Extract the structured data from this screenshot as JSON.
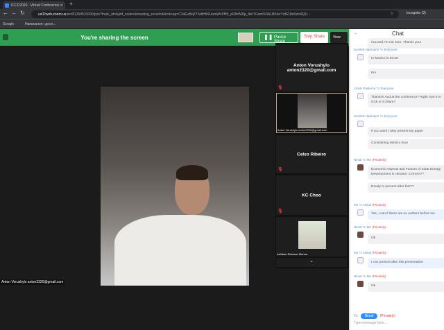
{
  "browser": {
    "tab_title": "ICCD2020 - Virtual Conference",
    "url_host": "us02web.zoom.us",
    "url_rest": "/wc/81269523090/join?track_id=&jmf_code=&meeting_result=&tk=&cap=C34GzBq272oBHiRUamWcPHft_sF8hW3lp_AtnTGam%3A1BKAcYzBZJbr0zio9QU...",
    "profile": "Incognito (3)",
    "bookmarks": [
      "Google",
      "Написання і досл..."
    ]
  },
  "share_bar": {
    "text": "You're sharing the screen",
    "pause_label": "Pause Share",
    "stop_label": "Stop Share",
    "view_label": "View"
  },
  "main_video": {
    "caption": "Anton Vorushylo anton2320@gmail.com"
  },
  "participants": [
    {
      "name": "Anton Vorushylo anton2320@gmail.com",
      "video": false
    },
    {
      "name": "Anton Vorushylo anton2320@gmail.com",
      "video": true
    },
    {
      "name": "Celso Ribeiro",
      "video": false
    },
    {
      "name": "KC Choo",
      "video": false
    },
    {
      "name": "Ashiban Rahman Munna",
      "video": true
    }
  ],
  "chat": {
    "title": "Chat",
    "to_label": "To:",
    "recipient": "Nimal",
    "privately": "(Privately)",
    "placeholder": "Type message here ...",
    "items": [
      {
        "kind": "msg",
        "text": "rica and I'm not sure. Thanks you!"
      },
      {
        "kind": "hdr",
        "from": "Scarlett Hartmann",
        "to": "Everyone"
      },
      {
        "kind": "msg",
        "text": "In Mexico is 20:29"
      },
      {
        "kind": "msg",
        "text": "Pm"
      },
      {
        "kind": "hdr",
        "from": "César Padierna",
        "to": "Everyone"
      },
      {
        "kind": "msg",
        "text": "Thanks!! And at the conference? Right now it is 9:29 or 9:29am?"
      },
      {
        "kind": "hdr",
        "from": "Scarlett Hartmann",
        "to": "Everyone"
      },
      {
        "kind": "msg",
        "text": "If you want I May present My paper"
      },
      {
        "kind": "msg",
        "text": "Considering Mexico hour"
      },
      {
        "kind": "hdr",
        "from": "Nimal",
        "to": "Me",
        "priv": "(Privately)"
      },
      {
        "kind": "msg",
        "text": "Economic Aspects and Factors of Solar Energy Development in Ukraine, COrrect??"
      },
      {
        "kind": "msg",
        "text": "Ready to present after this??"
      },
      {
        "kind": "hdr",
        "from": "Me",
        "to": "Nimal",
        "priv": "(Privately)"
      },
      {
        "kind": "msg",
        "text": "Yes, I can if there are no authors before me"
      },
      {
        "kind": "hdr",
        "from": "Nimal",
        "to": "Me",
        "priv": "(Privately)"
      },
      {
        "kind": "msg",
        "text": "Ok"
      },
      {
        "kind": "hdr",
        "from": "Me",
        "to": "Nimal",
        "priv": "(Privately)"
      },
      {
        "kind": "msg",
        "text": "I can present after this presentation"
      },
      {
        "kind": "hdr",
        "from": "Nimal",
        "to": "Me",
        "priv": "(Privately)"
      },
      {
        "kind": "msg",
        "text": "Ok"
      }
    ],
    "to_word": "To"
  }
}
